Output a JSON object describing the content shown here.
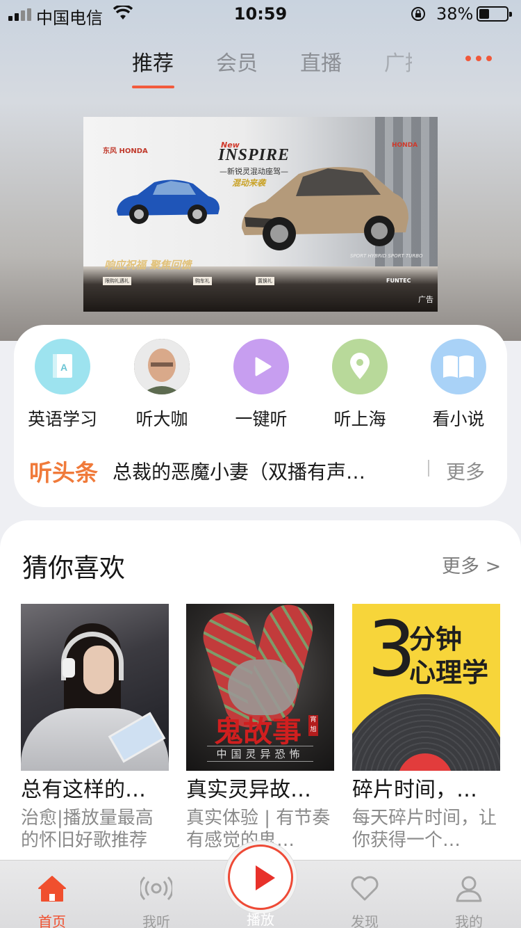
{
  "status_bar": {
    "carrier": "中国电信",
    "time": "10:59",
    "battery": "38%",
    "battery_level": 0.38
  },
  "top_tabs": [
    {
      "label": "推荐",
      "active": true
    },
    {
      "label": "会员",
      "active": false
    },
    {
      "label": "直播",
      "active": false
    },
    {
      "label": "广播",
      "active": false
    }
  ],
  "banner": {
    "brand_left": "东风 HONDA",
    "new": "New",
    "model": "INSPIRE",
    "subtitle": "—新锐灵混动座驾—",
    "slogan": "混动来袭",
    "brand_right": "HONDA",
    "tagline": "响应祝福 聚焦回馈",
    "promo_1": "限购礼遇礼",
    "promo_2": "购车礼",
    "promo_3": "置换礼",
    "sport": "SPORT HYBRID  SPORT TURBO",
    "funtec": "FUNTEC",
    "ad_label": "广告"
  },
  "quick_entries": [
    {
      "label": "英语学习",
      "icon": "english-learning-icon",
      "color": "#9de3ef"
    },
    {
      "label": "听大咖",
      "icon": "celebrity-avatar",
      "color": "#6f6b63"
    },
    {
      "label": "一键听",
      "icon": "play-icon",
      "color": "#c79ef0"
    },
    {
      "label": "听上海",
      "icon": "location-pin-icon",
      "color": "#b8d99a"
    },
    {
      "label": "看小说",
      "icon": "open-book-icon",
      "color": "#a9d2f7"
    }
  ],
  "headline": {
    "brand": "听头条",
    "text": "总裁的恶魔小妻（双播有声…",
    "more": "更多"
  },
  "recommend": {
    "title": "猜你喜欢",
    "more": "更多 >",
    "items": [
      {
        "title": "总有这样的…",
        "desc": "治愈|播放量最高的怀旧好歌推荐"
      },
      {
        "title": "真实灵异故…",
        "desc": "真实体验 | 有节奏有感觉的鬼…",
        "cover_title": "鬼故事",
        "cover_sub": "中国灵异恐怖",
        "cover_seal": "宵旭"
      },
      {
        "title": "碎片时间，…",
        "desc": "每天碎片时间，让你获得一个…",
        "cover_big": "3",
        "cover_line1": "分钟",
        "cover_line2": "心理学"
      }
    ]
  },
  "tabbar": {
    "items": [
      {
        "label": "首页",
        "active": true
      },
      {
        "label": "我听",
        "active": false
      },
      {
        "label": "播放",
        "active": false
      },
      {
        "label": "发现",
        "active": false
      },
      {
        "label": "我的",
        "active": false
      }
    ],
    "accent": "#f04f2e"
  }
}
